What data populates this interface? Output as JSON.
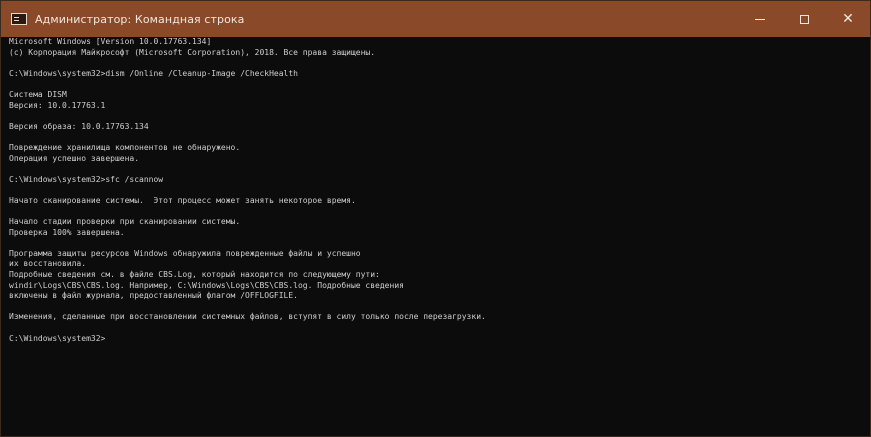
{
  "window": {
    "title": "Администратор: Командная строка",
    "controls": {
      "minimize": "minimize",
      "maximize": "maximize",
      "close": "✕"
    }
  },
  "console": {
    "lines": [
      "Microsoft Windows [Version 10.0.17763.134]",
      "(c) Корпорация Майкрософт (Microsoft Corporation), 2018. Все права защищены.",
      "",
      "C:\\Windows\\system32>dism /Online /Cleanup-Image /CheckHealth",
      "",
      "Система DISM",
      "Версия: 10.0.17763.1",
      "",
      "Версия образа: 10.0.17763.134",
      "",
      "Повреждение хранилища компонентов не обнаружено.",
      "Операция успешно завершена.",
      "",
      "C:\\Windows\\system32>sfc /scannow",
      "",
      "Начато сканирование системы.  Этот процесс может занять некоторое время.",
      "",
      "Начало стадии проверки при сканировании системы.",
      "Проверка 100% завершена.",
      "",
      "Программа защиты ресурсов Windows обнаружила поврежденные файлы и успешно",
      "их восстановила.",
      "Подробные сведения см. в файле CBS.Log, который находится по следующему пути:",
      "windir\\Logs\\CBS\\CBS.log. Например, C:\\Windows\\Logs\\CBS\\CBS.log. Подробные сведения",
      "включены в файл журнала, предоставленный флагом /OFFLOGFILE.",
      "",
      "Изменения, сделанные при восстановлении системных файлов, вступят в силу только после перезагрузки.",
      "",
      "C:\\Windows\\system32>"
    ]
  }
}
